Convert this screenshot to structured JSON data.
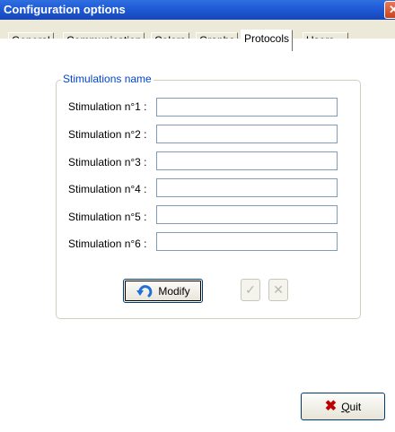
{
  "window": {
    "title": "Configuration options",
    "close_glyph": "✕"
  },
  "tabs": [
    {
      "label": "General"
    },
    {
      "label": "Communication"
    },
    {
      "label": "Colors"
    },
    {
      "label": "Graphs"
    },
    {
      "label": "Protocols"
    },
    {
      "label": "Users"
    }
  ],
  "active_tab": "Protocols",
  "group": {
    "title": "Stimulations name",
    "rows": [
      {
        "label": "Stimulation n°1 :",
        "value": ""
      },
      {
        "label": "Stimulation n°2 :",
        "value": ""
      },
      {
        "label": "Stimulation n°3 :",
        "value": ""
      },
      {
        "label": "Stimulation n°4 :",
        "value": ""
      },
      {
        "label": "Stimulation n°5 :",
        "value": ""
      },
      {
        "label": "Stimulation n°6 :",
        "value": ""
      }
    ]
  },
  "buttons": {
    "modify_label": "Modify",
    "validate_glyph": "✓",
    "cancel_glyph": "✕",
    "quit_label": "Quit",
    "quit_glyph": "✖"
  },
  "colors": {
    "title_bar": "#1f5ad6",
    "group_label": "#0046d5",
    "quit_icon": "#c00000",
    "undo_icon": "#1e6fd9"
  },
  "icons": {
    "modify": "undo-arrow-icon",
    "validate": "check-icon",
    "cancel": "cross-icon",
    "quit": "x-icon",
    "close": "close-icon"
  }
}
